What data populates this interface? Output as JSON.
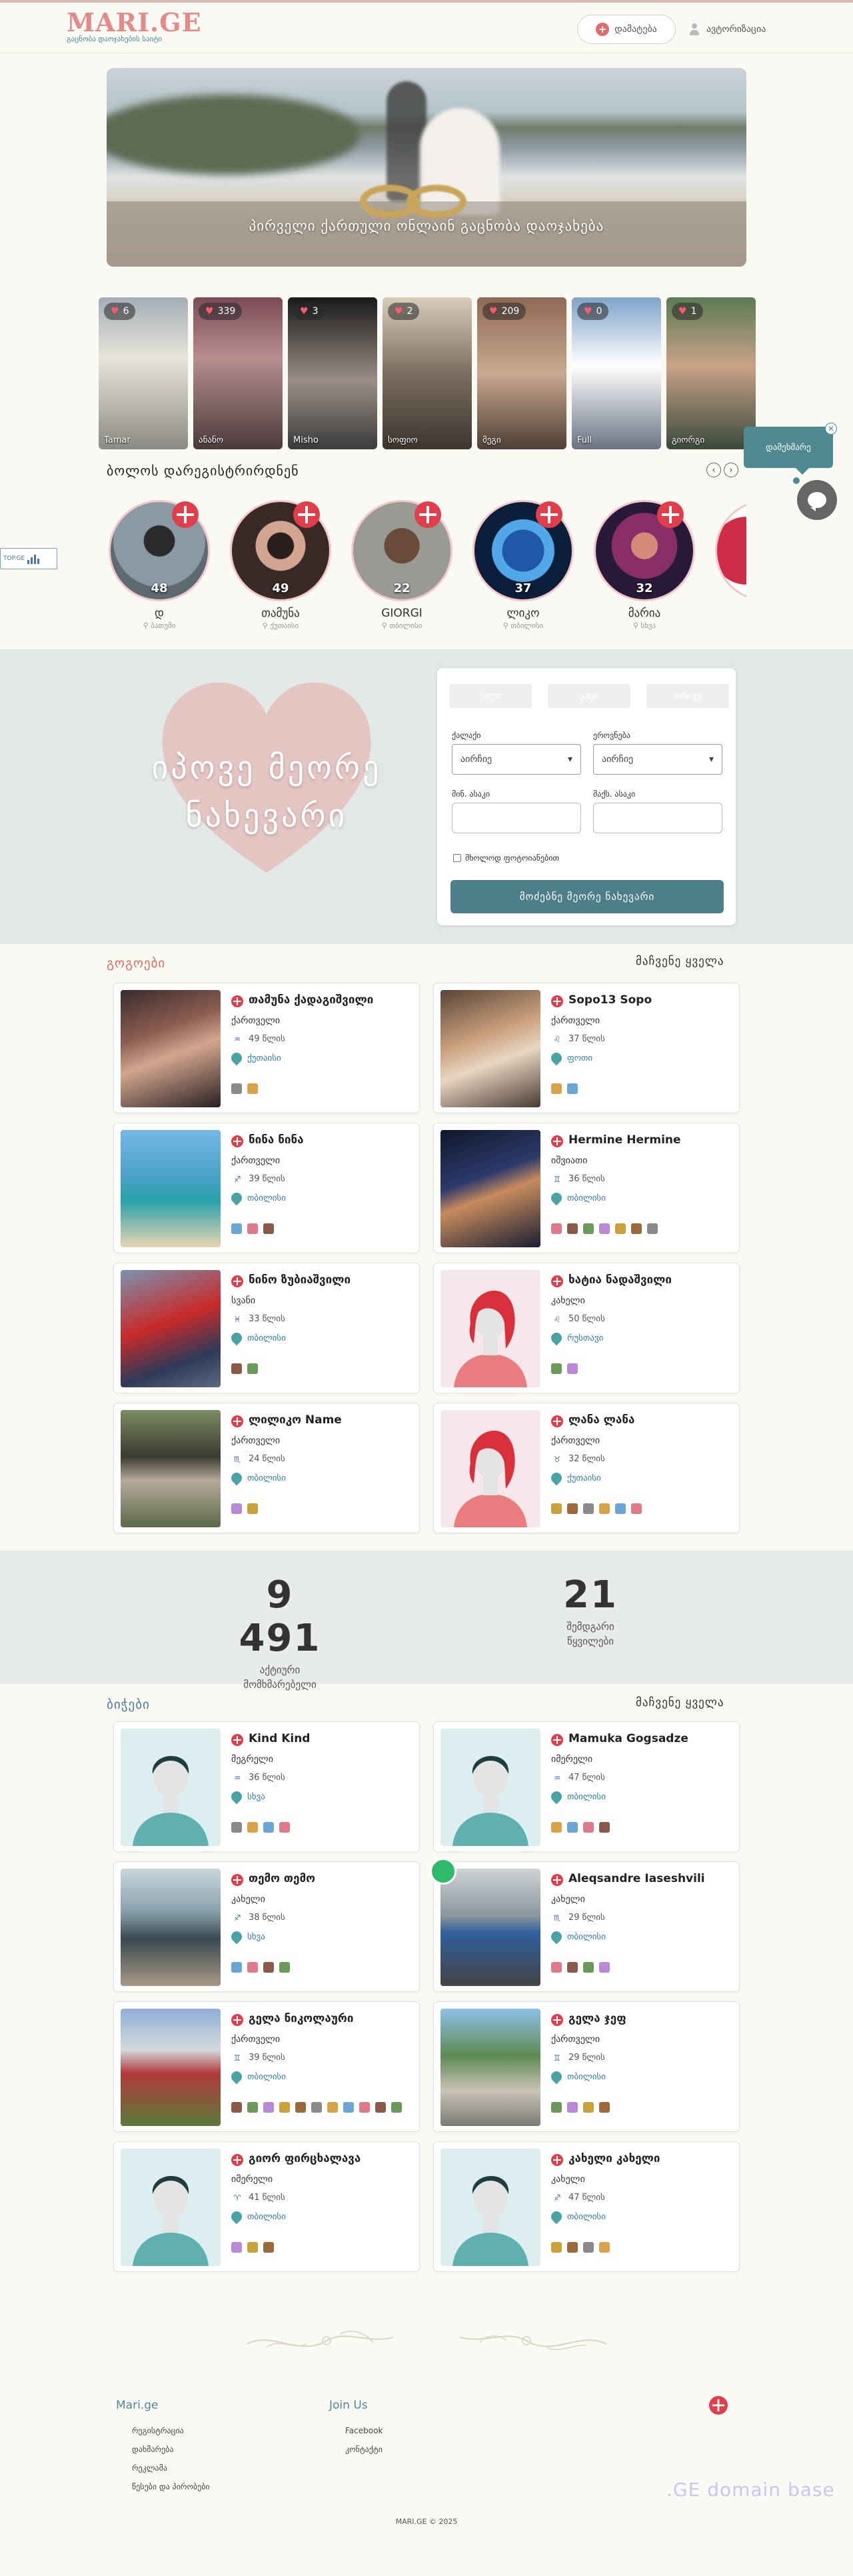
{
  "header": {
    "logo_text": "MARI.GE",
    "logo_subtitle": "გაცნობა დაოჯახების საიტი",
    "add_label": "დამატება",
    "auth_label": "ავტორიზაცია"
  },
  "hero": {
    "caption": "პირველი ქართული ონლაინ გაცნობა დაოჯახება"
  },
  "stories": [
    {
      "likes": "6",
      "name": "Tamar"
    },
    {
      "likes": "339",
      "name": "ანანო"
    },
    {
      "likes": "3",
      "name": "Misho"
    },
    {
      "likes": "2",
      "name": "სოფიო"
    },
    {
      "likes": "209",
      "name": "მეგი"
    },
    {
      "likes": "0",
      "name": "Full"
    },
    {
      "likes": "1",
      "name": "გიორგი"
    }
  ],
  "new_registered": {
    "title": "ბოლოს დარეგისტრირდნენ",
    "prev_icon": "chevron-left-icon",
    "next_icon": "chevron-right-icon",
    "items": [
      {
        "age": "48",
        "name": "დ",
        "location": "ბათუმი"
      },
      {
        "age": "49",
        "name": "თამუნა",
        "location": "ქუთაისი"
      },
      {
        "age": "22",
        "name": "GIORGI",
        "location": "თბილისი"
      },
      {
        "age": "37",
        "name": "ლიკო",
        "location": "თბილისი"
      },
      {
        "age": "32",
        "name": "მარია",
        "location": "სხვა"
      }
    ]
  },
  "search": {
    "slogan_line1": "იპოვე მეორე",
    "slogan_line2": "ნახევარი",
    "tabs": [
      "ქალი",
      "კაცი",
      "ორივე"
    ],
    "gender_label": "ქალაქი",
    "gender_value": "აირჩიე",
    "nationality_label": "ეროვნება",
    "nationality_value": "აირჩიე",
    "min_age_label": "მინ. ასაკი",
    "max_age_label": "მაქს. ასაკი",
    "only_photo_label": "მხოლოდ ფოტოიანებით",
    "submit_label": "მოძებნე მეორე ნახევარი"
  },
  "women": {
    "title": "გოგოები",
    "see_all": "მაჩვენე ყველა",
    "items": [
      {
        "name": "თამუნა ქადაგიშვილი",
        "nationality": "ქართველი",
        "age": "49 წლის",
        "location": "ქუთაისი",
        "zodiac": "♒"
      },
      {
        "name": "Sopo13 Sopo",
        "nationality": "ქართველი",
        "age": "37 წლის",
        "location": "ფოთი",
        "zodiac": "♌"
      },
      {
        "name": "ნინა ნინა",
        "nationality": "ქართველი",
        "age": "39 წლის",
        "location": "თბილისი",
        "zodiac": "♐"
      },
      {
        "name": "Hermine Hermine",
        "nationality": "იშვიათი",
        "age": "36 წლის",
        "location": "თბილისი",
        "zodiac": "♊"
      },
      {
        "name": "ნინო ზუბიაშვილი",
        "nationality": "სვანი",
        "age": "33 წლის",
        "location": "თბილისი",
        "zodiac": "♓"
      },
      {
        "name": "ხატია ნადაშვილი",
        "nationality": "კახელი",
        "age": "50 წლის",
        "location": "რუსთავი",
        "zodiac": "♌"
      },
      {
        "name": "ლილიკო Name",
        "nationality": "ქართველი",
        "age": "24 წლის",
        "location": "თბილისი",
        "zodiac": "♏"
      },
      {
        "name": "ლანა ლანა",
        "nationality": "ქართველი",
        "age": "32 წლის",
        "location": "ქუთაისი",
        "zodiac": "♉"
      }
    ]
  },
  "stats": {
    "active_value": "9 491",
    "active_label1": "აქტიური",
    "active_label2": "მომხმარებელი",
    "couples_value": "21",
    "couples_label1": "შემდგარი",
    "couples_label2": "წყვილები"
  },
  "men": {
    "title": "ბიჭები",
    "see_all": "მაჩვენე ყველა",
    "items": [
      {
        "name": "Kind Kind",
        "nationality": "მეგრელი",
        "age": "36 წლის",
        "location": "სხვა",
        "zodiac": "♒"
      },
      {
        "name": "Mamuka Gogsadze",
        "nationality": "იმერელი",
        "age": "47 წლის",
        "location": "თბილისი",
        "zodiac": "♒"
      },
      {
        "name": "თემო თემო",
        "nationality": "კახელი",
        "age": "38 წლის",
        "location": "სხვა",
        "zodiac": "♐"
      },
      {
        "name": "Aleqsandre Iaseshvili",
        "nationality": "კახელი",
        "age": "29 წლის",
        "location": "თბილისი",
        "zodiac": "♏"
      },
      {
        "name": "გელა ნიკოლაური",
        "nationality": "ქართველი",
        "age": "39 წლის",
        "location": "თბილისი",
        "zodiac": "♊"
      },
      {
        "name": "გელა ჯეფ",
        "nationality": "ქართველი",
        "age": "29 წლის",
        "location": "თბილისი",
        "zodiac": "♊"
      },
      {
        "name": "გიორ ფირცხალავა",
        "nationality": "იმერელი",
        "age": "41 წლის",
        "location": "თბილისი",
        "zodiac": "♈"
      },
      {
        "name": "კახელი კახელი",
        "nationality": "კახელი",
        "age": "47 წლის",
        "location": "თბილისი",
        "zodiac": "♐"
      }
    ]
  },
  "footer": {
    "col1_title": "Mari.ge",
    "col1_links": [
      "რეგისტრაცია",
      "დახმარება",
      "რეკლამა",
      "წესები და პირობები"
    ],
    "col2_title": "Join Us",
    "col2_links": [
      "Facebook",
      "კონტაქტი"
    ],
    "domain_base": ".GE domain base",
    "copyright": "MARI.GE © 2025"
  },
  "widgets": {
    "chat_label": "დამეხმარე",
    "badge_text": "TOP.GE"
  },
  "colors": {
    "accent": "#4d7f8a",
    "brand": "#e38a8a",
    "flag_red": "#e23d4a"
  }
}
